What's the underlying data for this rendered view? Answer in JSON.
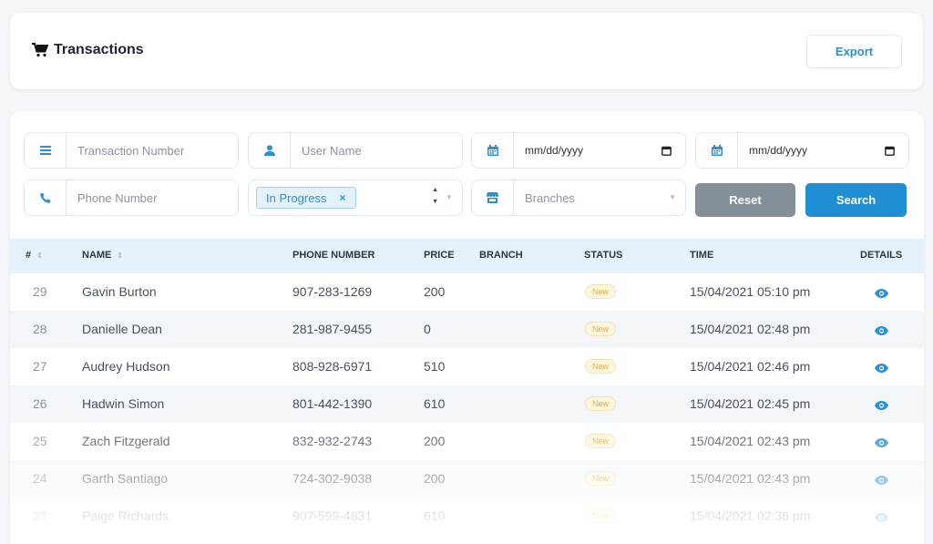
{
  "header": {
    "title": "Transactions",
    "export_label": "Export"
  },
  "filters": {
    "transaction_number_placeholder": "Transaction Number",
    "user_name_placeholder": "User Name",
    "date_from": "mm/dd/yyyy",
    "date_to": "mm/dd/yyyy",
    "phone_number_placeholder": "Phone Number",
    "status_chip": "In Progress",
    "status_chip_remove": "×",
    "branches_placeholder": "Branches",
    "reset_label": "Reset",
    "search_label": "Search"
  },
  "table": {
    "columns": {
      "id": "#",
      "name": "NAME",
      "phone": "PHONE NUMBER",
      "price": "PRICE",
      "branch": "BRANCH",
      "status": "STATUS",
      "time": "TIME",
      "details": "DETAILS"
    },
    "rows": [
      {
        "id": "29",
        "name": "Gavin Burton",
        "phone": "907-283-1269",
        "price": "200",
        "branch": "",
        "status": "New",
        "time": "15/04/2021 05:10 pm"
      },
      {
        "id": "28",
        "name": "Danielle Dean",
        "phone": "281-987-9455",
        "price": "0",
        "branch": "",
        "status": "New",
        "time": "15/04/2021 02:48 pm"
      },
      {
        "id": "27",
        "name": "Audrey Hudson",
        "phone": "808-928-6971",
        "price": "510",
        "branch": "",
        "status": "New",
        "time": "15/04/2021 02:46 pm"
      },
      {
        "id": "26",
        "name": "Hadwin Simon",
        "phone": "801-442-1390",
        "price": "610",
        "branch": "",
        "status": "New",
        "time": "15/04/2021 02:45 pm"
      },
      {
        "id": "25",
        "name": "Zach Fitzgerald",
        "phone": "832-932-2743",
        "price": "200",
        "branch": "",
        "status": "New",
        "time": "15/04/2021 02:43 pm"
      },
      {
        "id": "24",
        "name": "Garth Santiago",
        "phone": "724-302-9038",
        "price": "200",
        "branch": "",
        "status": "New",
        "time": "15/04/2021 02:43 pm"
      },
      {
        "id": "23",
        "name": "Paige Richards",
        "phone": "907-599-4831",
        "price": "610",
        "branch": "",
        "status": "New",
        "time": "15/04/2021 02:36 pm"
      }
    ]
  },
  "colors": {
    "accent": "#1f8ed3",
    "reset": "#838f99",
    "badge_bg": "#fff6dc",
    "badge_text": "#f2a93b",
    "header_row": "#e6f2fb"
  },
  "icons": [
    "cart-icon",
    "list-icon",
    "user-icon",
    "calendar-icon",
    "phone-icon",
    "store-icon",
    "eye-icon",
    "sort-icon"
  ]
}
